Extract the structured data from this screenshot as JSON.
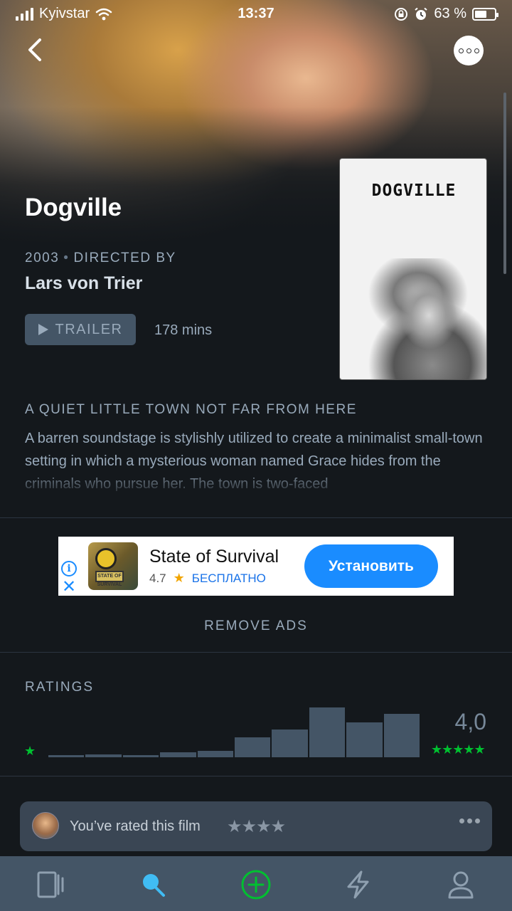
{
  "status_bar": {
    "carrier": "Kyivstar",
    "time": "13:37",
    "battery": "63 %",
    "battery_level": 0.63
  },
  "film": {
    "title": "Dogville",
    "year": "2003",
    "directed_by_label": "DIRECTED BY",
    "director": "Lars von Trier",
    "trailer_label": "TRAILER",
    "runtime": "178 mins",
    "poster_title": "DOGVILLE",
    "tagline": "A QUIET LITTLE TOWN NOT FAR FROM HERE",
    "synopsis": "A barren soundstage is stylishly utilized to create a minimalist small-town setting in which a mysterious woman named Grace hides from the criminals who pursue her. The town is two-faced"
  },
  "ad": {
    "title": "State of Survival",
    "rating": "4.7",
    "price": "БЕСПЛАТНО",
    "install_label": "Установить",
    "icon_sign_text": "STATE OF SURVIVAL"
  },
  "remove_ads_label": "REMOVE ADS",
  "ratings": {
    "label": "RATINGS",
    "average": "4,0",
    "low_star": "★",
    "high_stars": "★★★★★",
    "histogram": [
      1,
      1.5,
      1,
      2.5,
      3,
      9.5,
      13,
      23.5,
      16.5,
      20.5
    ],
    "histogram_max": 23.5
  },
  "your_rating": {
    "text": "You’ve rated this film",
    "stars": "★★★★"
  },
  "colors": {
    "background": "#14181c",
    "accent_green": "#00c030",
    "bar": "#445566",
    "install_blue": "#1a8cff"
  },
  "tabs": [
    "films-icon",
    "search-icon",
    "add-icon",
    "activity-icon",
    "profile-icon"
  ]
}
